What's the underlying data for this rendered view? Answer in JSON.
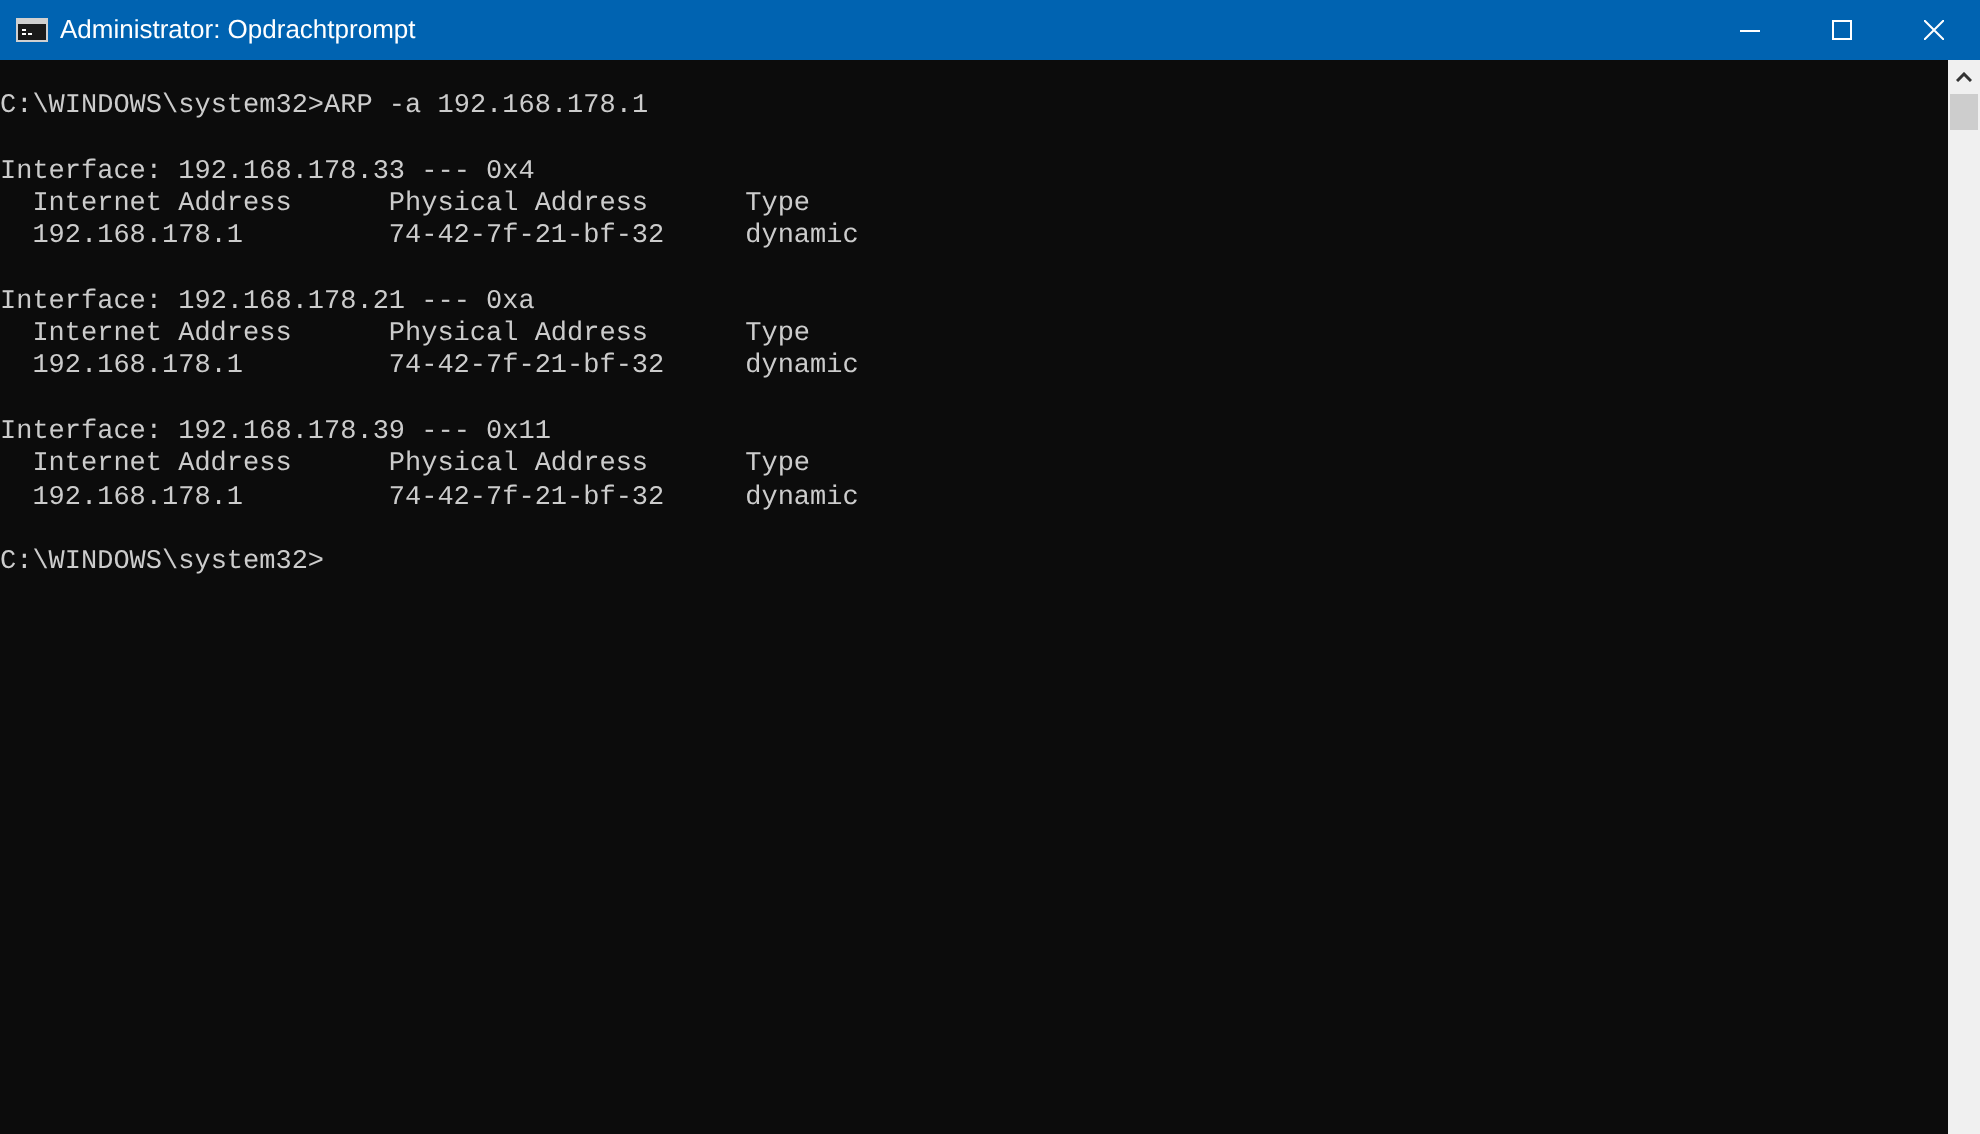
{
  "window": {
    "title": "Administrator: Opdrachtprompt"
  },
  "console": {
    "command_line": "C:\\WINDOWS\\system32>ARP -a 192.168.178.1",
    "interfaces": [
      {
        "header": "Interface: 192.168.178.33 --- 0x4",
        "columns": [
          "Internet Address",
          "Physical Address",
          "Type"
        ],
        "rows": [
          [
            "192.168.178.1",
            "74-42-7f-21-bf-32",
            "dynamic"
          ]
        ]
      },
      {
        "header": "Interface: 192.168.178.21 --- 0xa",
        "columns": [
          "Internet Address",
          "Physical Address",
          "Type"
        ],
        "rows": [
          [
            "192.168.178.1",
            "74-42-7f-21-bf-32",
            "dynamic"
          ]
        ]
      },
      {
        "header": "Interface: 192.168.178.39 --- 0x11",
        "columns": [
          "Internet Address",
          "Physical Address",
          "Type"
        ],
        "rows": [
          [
            "192.168.178.1",
            "74-42-7f-21-bf-32",
            "dynamic"
          ]
        ]
      }
    ],
    "prompt": "C:\\WINDOWS\\system32>"
  }
}
